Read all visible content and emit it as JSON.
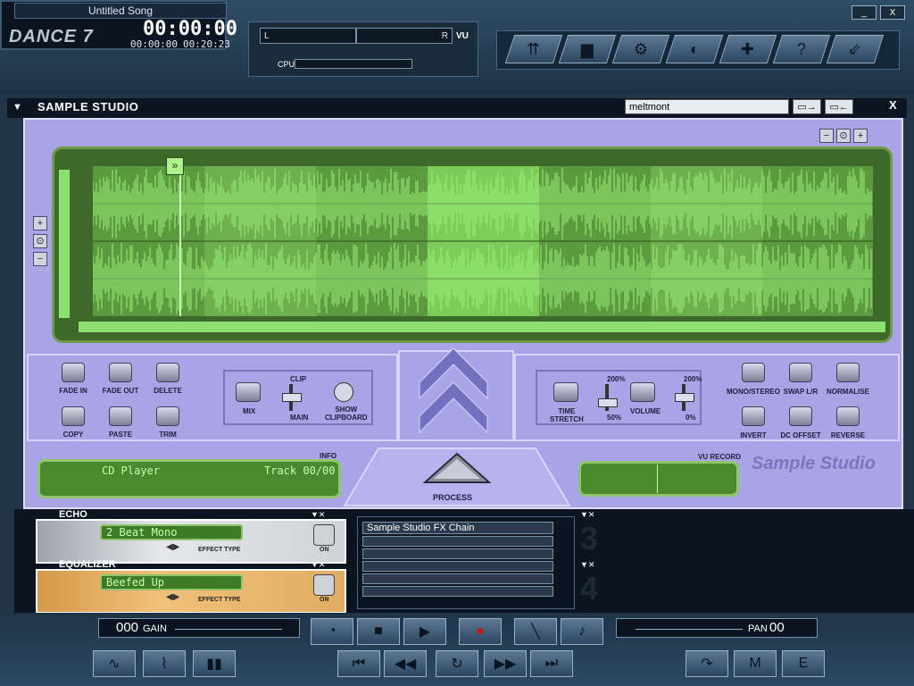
{
  "app": {
    "song_title": "Untitled Song",
    "logo": "DANCE 7",
    "time_main": "00:00:00",
    "time_elapsed": "00:00:00",
    "time_total": "00:20:23"
  },
  "meters": {
    "vu_left": "L",
    "vu_right": "R",
    "vu_label": "VU",
    "cpu_label": "CPU"
  },
  "toolbar": {
    "icons": [
      "upload-list-icon",
      "folder-icon",
      "mixer-icon",
      "globe-icon",
      "settings-icon",
      "help-icon",
      "minimize-to-tray-icon"
    ]
  },
  "window": {
    "minimize": "_",
    "close": "X"
  },
  "sample_studio": {
    "title": "SAMPLE STUDIO",
    "file_value": "meltmont",
    "close": "X",
    "zoom": [
      "-",
      "search",
      "+"
    ],
    "edit_buttons": [
      "FADE IN",
      "FADE OUT",
      "DELETE",
      "COPY",
      "PASTE",
      "TRIM"
    ],
    "mix": {
      "label": "MIX",
      "clip": "CLIP",
      "main": "MAIN",
      "show_clipboard": "SHOW\nCLIPBOARD"
    },
    "stretch": {
      "label": "TIME\nSTRETCH",
      "max": "200%",
      "min": "50%"
    },
    "volume": {
      "label": "VOLUME",
      "max": "200%",
      "min": "0%"
    },
    "fx_buttons": [
      "MONO/STEREO",
      "SWAP L/R",
      "NORMALISE",
      "INVERT",
      "DC OFFSET",
      "REVERSE"
    ],
    "info": {
      "label": "INFO",
      "source": "CD Player",
      "track": "Track 00/00"
    },
    "process": "PROCESS",
    "vu_record": "VU RECORD",
    "brand": "Sample Studio"
  },
  "effects": [
    {
      "name": "ECHO",
      "value": "2 Beat Mono",
      "type_label": "EFFECT TYPE",
      "on_label": "ON"
    },
    {
      "name": "EQUALIZER",
      "value": "Beefed Up",
      "type_label": "EFFECT TYPE",
      "on_label": "ON"
    }
  ],
  "fx_chain": {
    "title": "Sample Studio FX Chain"
  },
  "slots": [
    "3",
    "4"
  ],
  "mixer": {
    "gain_value": "000",
    "gain_label": "GAIN",
    "pan_label": "PAN",
    "pan_value": "00"
  },
  "colors": {
    "bg": "#223649",
    "studio": "#a8a4e6",
    "wave": "#4f8a35",
    "wave_light": "#8be070"
  }
}
